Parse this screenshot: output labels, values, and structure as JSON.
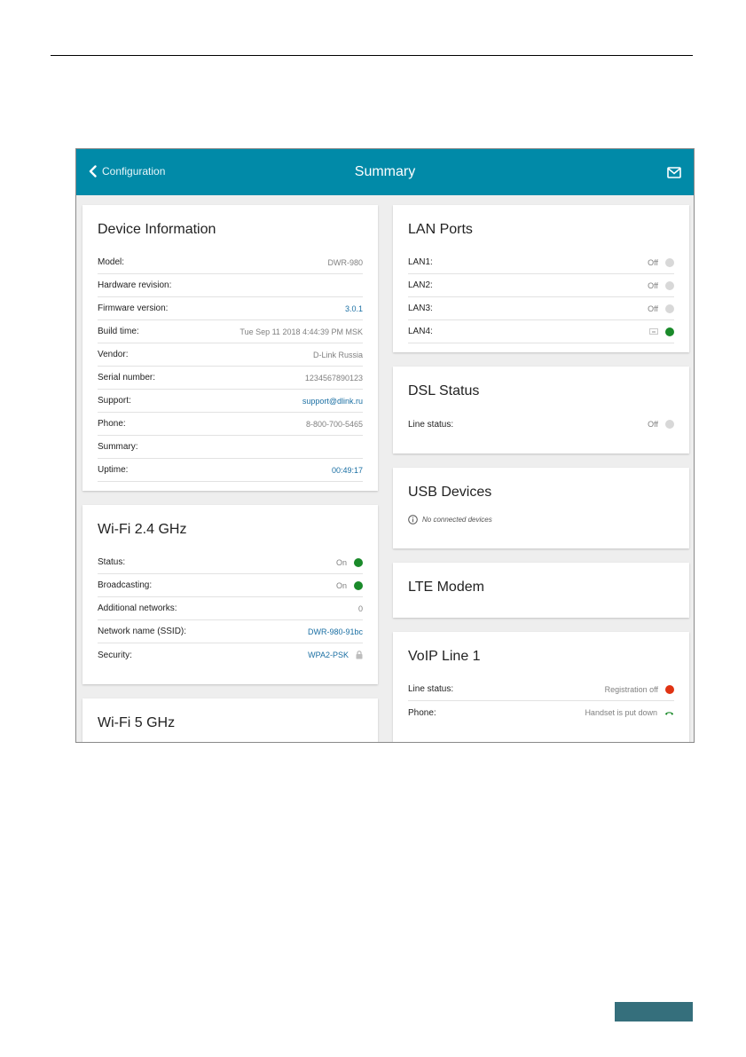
{
  "header": {
    "back_label": "Configuration",
    "title": "Summary"
  },
  "device_info": {
    "title": "Device Information",
    "rows": [
      {
        "label": "Model:",
        "value": "DWR-980"
      },
      {
        "label": "Hardware revision:",
        "value": ""
      },
      {
        "label": "Firmware version:",
        "value": "3.0.1"
      },
      {
        "label": "Build time:",
        "value": "Tue Sep 11 2018 4:44:39 PM MSK"
      },
      {
        "label": "Vendor:",
        "value": "D-Link Russia"
      },
      {
        "label": "Serial number:",
        "value": "1234567890123"
      },
      {
        "label": "Support:",
        "value": "support@dlink.ru"
      },
      {
        "label": "Phone:",
        "value": "8-800-700-5465"
      },
      {
        "label": "Summary:",
        "value": ""
      },
      {
        "label": "Uptime:",
        "value": "00:49:17"
      }
    ]
  },
  "wifi24": {
    "title": "Wi-Fi 2.4 GHz",
    "rows": [
      {
        "label": "Status:",
        "value": "On"
      },
      {
        "label": "Broadcasting:",
        "value": "On"
      },
      {
        "label": "Additional networks:",
        "value": "0"
      },
      {
        "label": "Network name (SSID):",
        "value": "DWR-980-91bc"
      },
      {
        "label": "Security:",
        "value": "WPA2-PSK"
      }
    ]
  },
  "wifi5": {
    "title": "Wi-Fi 5 GHz"
  },
  "lan": {
    "title": "LAN Ports",
    "rows": [
      {
        "label": "LAN1:",
        "value": "Off"
      },
      {
        "label": "LAN2:",
        "value": "Off"
      },
      {
        "label": "LAN3:",
        "value": "Off"
      },
      {
        "label": "LAN4:",
        "value": ""
      }
    ]
  },
  "dsl": {
    "title": "DSL Status",
    "rows": [
      {
        "label": "Line status:",
        "value": "Off"
      }
    ]
  },
  "usb": {
    "title": "USB Devices",
    "empty_text": "No connected devices"
  },
  "lte": {
    "title": "LTE Modem"
  },
  "voip": {
    "title": "VoIP Line 1",
    "rows": [
      {
        "label": "Line status:",
        "value": "Registration off"
      },
      {
        "label": "Phone:",
        "value": "Handset is put down"
      }
    ]
  },
  "colors": {
    "header": "#018aa8",
    "status_on": "#1a8a2a",
    "status_off": "#d8d8d8",
    "status_error": "#e03313",
    "link": "#1a6fa3"
  },
  "icons": [
    "chevron-left-icon",
    "mail-icon",
    "lock-icon",
    "info-icon",
    "ethernet-icon",
    "handset-icon"
  ]
}
